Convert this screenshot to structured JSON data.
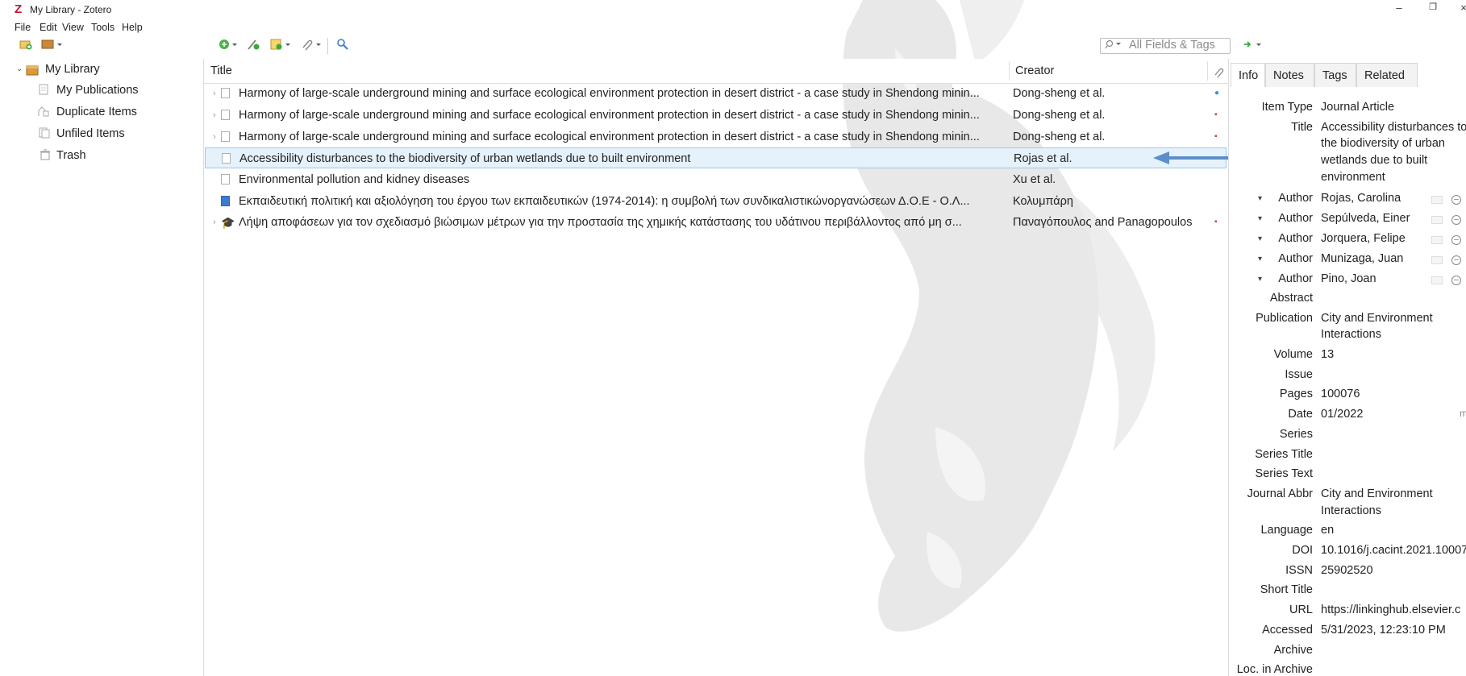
{
  "window": {
    "title": "My Library - Zotero",
    "controls": [
      "–",
      "❐",
      "×"
    ]
  },
  "menu": {
    "items": [
      "File",
      "Edit",
      "View",
      "Tools",
      "Help"
    ]
  },
  "toolbar": {
    "search_placeholder": "All Fields & Tags"
  },
  "collections": [
    {
      "label": "My Library",
      "icon": "library-icon"
    },
    {
      "label": "My Publications",
      "icon": "publications-icon"
    },
    {
      "label": "Duplicate Items",
      "icon": "duplicates-icon"
    },
    {
      "label": "Unfiled Items",
      "icon": "unfiled-icon"
    },
    {
      "label": "Trash",
      "icon": "trash-icon"
    }
  ],
  "items_table": {
    "columns": [
      "Title",
      "Creator"
    ],
    "rows": [
      {
        "title": "Harmony of large-scale underground mining and surface ecological environment protection in desert district - a case study in Shendong minin...",
        "creator": "Dong-sheng et al.",
        "type": "article",
        "attachment": "note"
      },
      {
        "title": "Harmony of large-scale underground mining and surface ecological environment protection in desert district - a case study in Shendong minin...",
        "creator": "Dong-sheng et al.",
        "type": "article",
        "attachment": "pdf"
      },
      {
        "title": "Harmony of large-scale underground mining and surface ecological environment protection in desert district - a case study in Shendong minin...",
        "creator": "Dong-sheng et al.",
        "type": "article",
        "attachment": "pdf"
      },
      {
        "title": "Accessibility disturbances to the biodiversity of urban wetlands due to built environment",
        "creator": "Rojas et al.",
        "type": "article",
        "attachment": ""
      },
      {
        "title": "Environmental pollution and kidney diseases",
        "creator": "Xu et al.",
        "type": "article",
        "attachment": ""
      },
      {
        "title": "Εκπαιδευτική πολιτική και αξιολόγηση του έργου των εκπαιδευτικών (1974-2014): η συμβολή των συνδικαλιστικώνοργανώσεων Δ.Ο.Ε - Ο.Λ...",
        "creator": "Κολυμπάρη",
        "type": "book",
        "attachment": ""
      },
      {
        "title": "Λήψη αποφάσεων για τον σχεδιασμό βιώσιμων μέτρων για την προστασία της χημικής κατάστασης του υδάτινου περιβάλλοντος από μη σ...",
        "creator": "Παναγόπουλος and Panagopoulos",
        "type": "thesis",
        "attachment": "pdf"
      }
    ]
  },
  "item_pane": {
    "tabs": [
      "Info",
      "Notes",
      "Tags",
      "Related"
    ],
    "fields": {
      "item_type": {
        "label": "Item Type",
        "value": "Journal Article"
      },
      "title": {
        "label": "Title",
        "value_lines": [
          "Accessibility disturbances to",
          "the biodiversity of urban",
          "wetlands due to built",
          "environment"
        ]
      },
      "authors": [
        {
          "label": "Author",
          "value": "Rojas, Carolina"
        },
        {
          "label": "Author",
          "value": "Sepúlveda, Einer"
        },
        {
          "label": "Author",
          "value": "Jorquera, Felipe"
        },
        {
          "label": "Author",
          "value": "Munizaga, Juan"
        },
        {
          "label": "Author",
          "value": "Pino, Joan"
        }
      ],
      "abstract": {
        "label": "Abstract",
        "value": ""
      },
      "publication": {
        "label": "Publication",
        "value_lines": [
          "City and Environment",
          "Interactions"
        ]
      },
      "volume": {
        "label": "Volume",
        "value": "13"
      },
      "issue": {
        "label": "Issue",
        "value": ""
      },
      "pages": {
        "label": "Pages",
        "value": "100076"
      },
      "date": {
        "label": "Date",
        "value": "01/2022",
        "suffix": "m"
      },
      "series": {
        "label": "Series",
        "value": ""
      },
      "series_title": {
        "label": "Series Title",
        "value": ""
      },
      "series_text": {
        "label": "Series Text",
        "value": ""
      },
      "journal_abbr": {
        "label": "Journal Abbr",
        "value_lines": [
          "City and Environment",
          "Interactions"
        ]
      },
      "language": {
        "label": "Language",
        "value": "en"
      },
      "doi": {
        "label": "DOI",
        "value": "10.1016/j.cacint.2021.10007"
      },
      "issn": {
        "label": "ISSN",
        "value": "25902520"
      },
      "short_title": {
        "label": "Short Title",
        "value": ""
      },
      "url": {
        "label": "URL",
        "value": "https://linkinghub.elsevier.c"
      },
      "accessed": {
        "label": "Accessed",
        "value": "5/31/2023, 12:23:10 PM"
      },
      "archive": {
        "label": "Archive",
        "value": ""
      },
      "loc_in_archive": {
        "label": "Loc. in Archive",
        "value": ""
      }
    }
  },
  "colors": {
    "selection": "#e5f1fb",
    "selection_border": "#9fc7ea",
    "arrow": "#5b8fc9",
    "pdf_red": "#d23b3b",
    "note_blue": "#3d8fd6"
  }
}
